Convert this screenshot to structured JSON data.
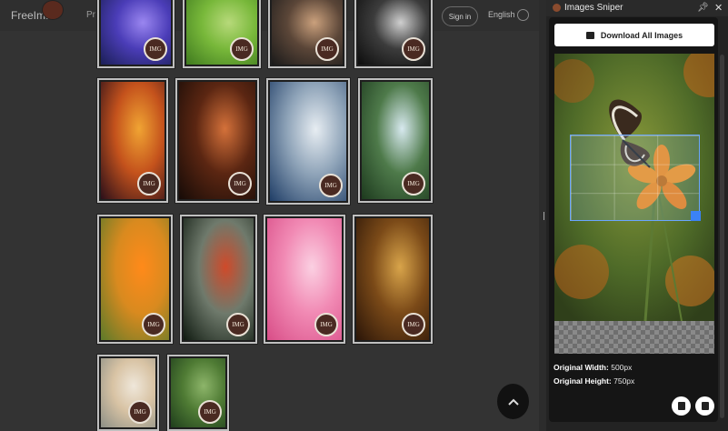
{
  "site": {
    "logo": "FreeIma",
    "nav_fragment": "Pr",
    "sign_in": "Sign in",
    "language": "English"
  },
  "gallery": {
    "badge_text": "IMG",
    "cards": [
      {
        "subject": "purple flower",
        "colors": [
          "#1b1f55",
          "#4b3db8",
          "#9a86f0"
        ]
      },
      {
        "subject": "green leaf",
        "colors": [
          "#3f7a1f",
          "#78b83a",
          "#b7d97a"
        ]
      },
      {
        "subject": "hands sepia",
        "colors": [
          "#1a1a1a",
          "#5b4638",
          "#caa07c"
        ]
      },
      {
        "subject": "metal sphere",
        "colors": [
          "#0d0d0d",
          "#3c3c3c",
          "#cfcfcf"
        ]
      },
      {
        "subject": "pier sunset",
        "colors": [
          "#2a0f1a",
          "#c4521c",
          "#f0a433"
        ]
      },
      {
        "subject": "jellyfish",
        "colors": [
          "#160b07",
          "#5b2612",
          "#d4713a"
        ]
      },
      {
        "subject": "building facade",
        "colors": [
          "#1f3d66",
          "#8ea3b8",
          "#e7edf2"
        ]
      },
      {
        "subject": "forest rays",
        "colors": [
          "#1d3a1e",
          "#4e7a4a",
          "#d7e9ef"
        ]
      },
      {
        "subject": "butterfly flower",
        "colors": [
          "#5c7a2a",
          "#d98a1f",
          "#ff8a1a"
        ]
      },
      {
        "subject": "bird head",
        "colors": [
          "#0f1a10",
          "#6f7a6c",
          "#cf4a2a"
        ]
      },
      {
        "subject": "pink tulip",
        "colors": [
          "#d84d87",
          "#f18ab4",
          "#fbd0e2"
        ]
      },
      {
        "subject": "ornate interior",
        "colors": [
          "#2a1508",
          "#7b4a18",
          "#d8a44a"
        ]
      },
      {
        "subject": "man portrait",
        "colors": [
          "#8c8f86",
          "#d8c3a4",
          "#efe7da"
        ]
      },
      {
        "subject": "green tree",
        "colors": [
          "#1f3e1c",
          "#4f7b34",
          "#8db56a"
        ]
      }
    ]
  },
  "extension": {
    "title": "Images Sniper",
    "download_all_label": "Download All Images",
    "original_width_label": "Original Width:",
    "original_width_value": "500px",
    "original_height_label": "Original Height:",
    "original_height_value": "750px"
  },
  "colors": {
    "accent_blue": "#3b82f6",
    "panel_bg": "#151515",
    "page_bg": "#333333"
  },
  "icons": {
    "extension_logo": "extension-logo-icon",
    "pin": "pin-icon",
    "close": "close-icon",
    "download": "download-folder-icon",
    "delete": "trash-icon",
    "save": "folder-save-icon",
    "scroll_top": "chevron-up-icon"
  }
}
